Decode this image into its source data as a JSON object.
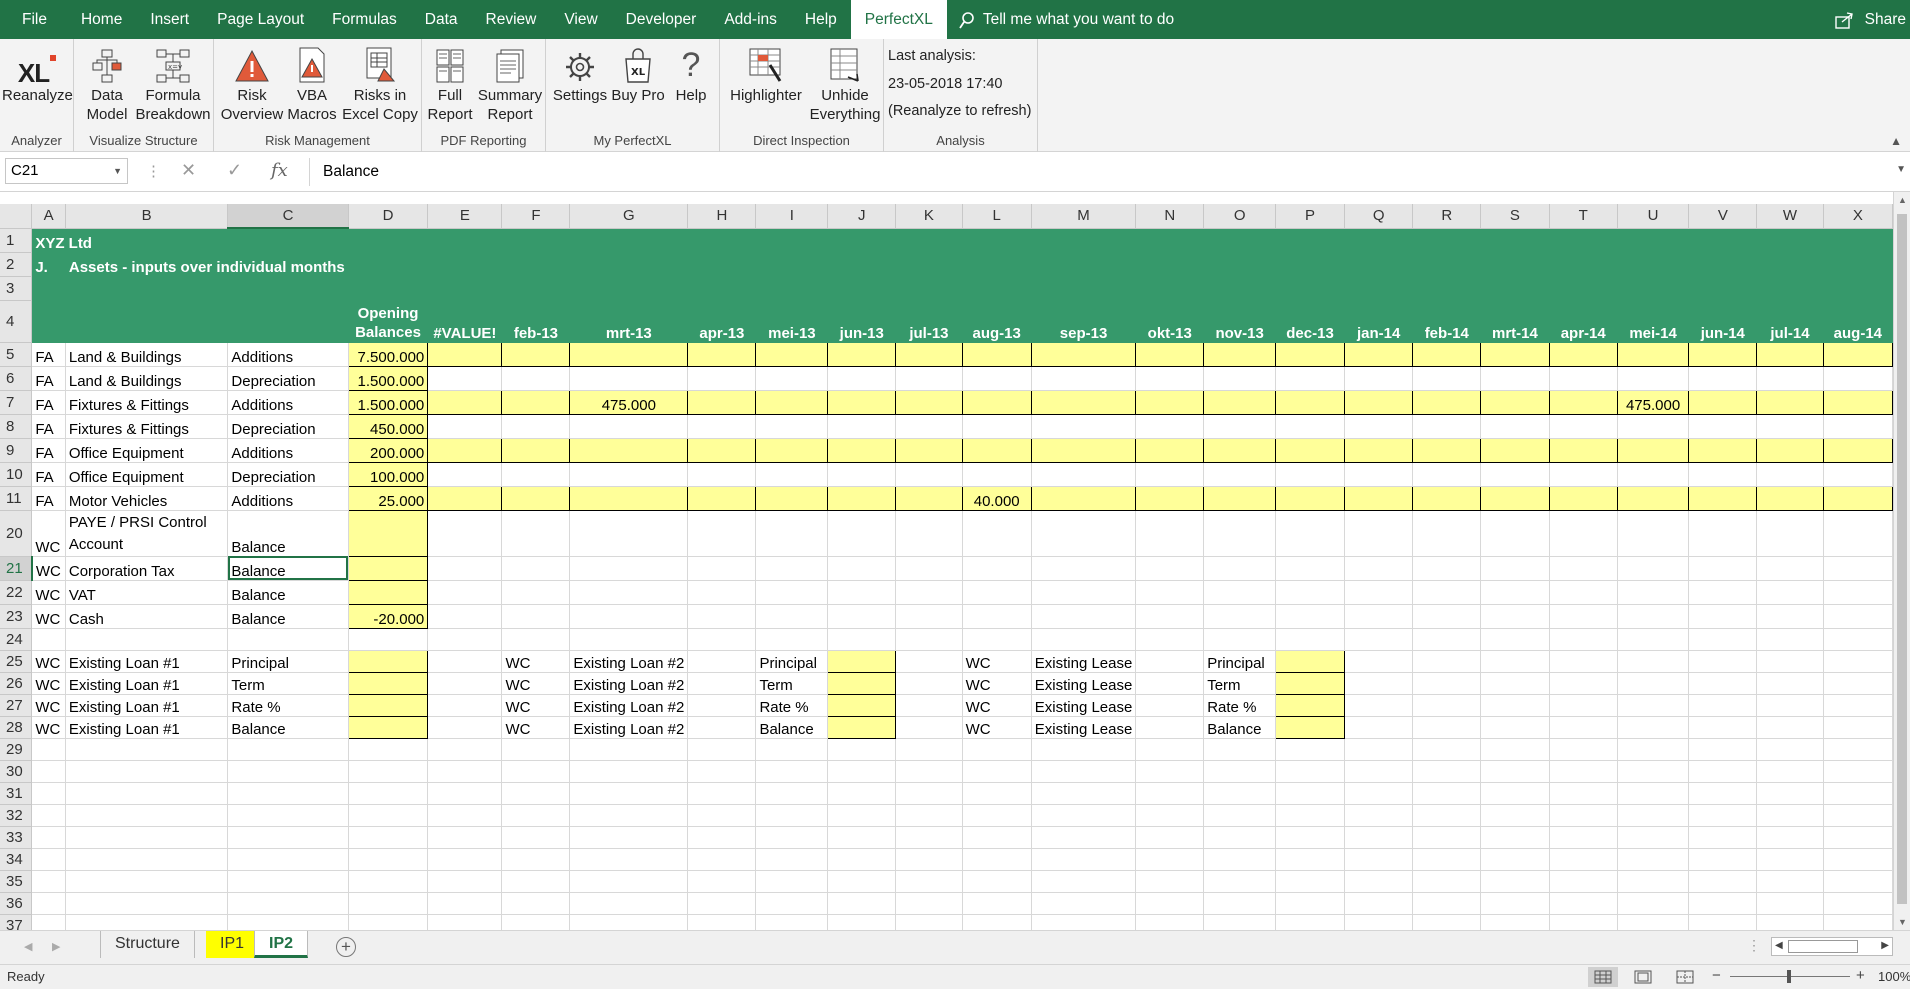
{
  "menu": {
    "tabs": [
      "File",
      "Home",
      "Insert",
      "Page Layout",
      "Formulas",
      "Data",
      "Review",
      "View",
      "Developer",
      "Add-ins",
      "Help",
      "PerfectXL"
    ],
    "tell_me": "Tell me what you want to do",
    "share": "Share"
  },
  "ribbon": {
    "groups": {
      "analyzer": "Analyzer",
      "visualize": "Visualize Structure",
      "risk": "Risk Management",
      "pdf": "PDF Reporting",
      "myperfectxl": "My PerfectXL",
      "inspection": "Direct Inspection",
      "analysis": "Analysis"
    },
    "buttons": {
      "reanalyze": "Reanalyze",
      "data_model": "Data\nModel",
      "formula_breakdown": "Formula\nBreakdown",
      "risk_overview": "Risk\nOverview",
      "vba_macros": "VBA\nMacros",
      "risks_excel_copy": "Risks in\nExcel Copy",
      "full_report": "Full\nReport",
      "summary_report": "Summary\nReport",
      "settings": "Settings",
      "buy_pro": "Buy Pro",
      "help": "Help",
      "highlighter": "Highlighter",
      "unhide": "Unhide\nEverything"
    },
    "logo_text": "XL",
    "last_analysis_label": "Last analysis:",
    "last_analysis_time": "23-05-2018 17:40",
    "refresh_hint": "(Reanalyze to refresh)"
  },
  "formula_bar": {
    "name_box": "C21",
    "formula": "Balance"
  },
  "columns": [
    "A",
    "B",
    "C",
    "D",
    "E",
    "F",
    "G",
    "H",
    "I",
    "J",
    "K",
    "L",
    "M",
    "N",
    "O",
    "P",
    "Q",
    "R",
    "S",
    "T",
    "U",
    "V",
    "W",
    "X"
  ],
  "sheet": {
    "title": "XYZ Ltd",
    "section_letter": "J.",
    "section_title": "Assets - inputs over individual months",
    "opening_1": "Opening",
    "opening_2": "Balances",
    "month_headers": [
      "#VALUE!",
      "feb-13",
      "mrt-13",
      "apr-13",
      "mei-13",
      "jun-13",
      "jul-13",
      "aug-13",
      "sep-13",
      "okt-13",
      "nov-13",
      "dec-13",
      "jan-14",
      "feb-14",
      "mrt-14",
      "apr-14",
      "mei-14",
      "jun-14",
      "jul-14",
      "aug-14"
    ],
    "asset_rows": [
      {
        "row": "5",
        "a": "FA",
        "b": "Land & Buildings",
        "c": "Additions",
        "d": "7.500.000",
        "months": {}
      },
      {
        "row": "6",
        "a": "FA",
        "b": "Land & Buildings",
        "c": "Depreciation",
        "d": "1.500.000",
        "months": {}
      },
      {
        "row": "7",
        "a": "FA",
        "b": "Fixtures & Fittings",
        "c": "Additions",
        "d": "1.500.000",
        "months": {
          "G": "475.000",
          "U": "475.000"
        }
      },
      {
        "row": "8",
        "a": "FA",
        "b": "Fixtures & Fittings",
        "c": "Depreciation",
        "d": "450.000",
        "months": {}
      },
      {
        "row": "9",
        "a": "FA",
        "b": "Office Equipment",
        "c": "Additions",
        "d": "200.000",
        "months": {}
      },
      {
        "row": "10",
        "a": "FA",
        "b": "Office Equipment",
        "c": "Depreciation",
        "d": "100.000",
        "months": {}
      },
      {
        "row": "11",
        "a": "FA",
        "b": "Motor Vehicles",
        "c": "Additions",
        "d": "25.000",
        "months": {
          "L": "40.000"
        }
      }
    ],
    "wc_rows": [
      {
        "row": "20",
        "a": "WC",
        "b1": "PAYE / PRSI Control",
        "b2": "Account",
        "c": "Balance",
        "d": ""
      },
      {
        "row": "21",
        "a": "WC",
        "b": "Corporation Tax",
        "c": "Balance",
        "d": ""
      },
      {
        "row": "22",
        "a": "WC",
        "b": "VAT",
        "c": "Balance",
        "d": ""
      },
      {
        "row": "23",
        "a": "WC",
        "b": "Cash",
        "c": "Balance",
        "d": "-20.000"
      }
    ],
    "loan_rows": [
      {
        "row": "25",
        "a": "WC",
        "loan1": "Existing Loan #1",
        "f1": "Principal",
        "loan2": "Existing Loan #2",
        "f2": "Principal",
        "lease": "Existing Lease",
        "f3": "Principal"
      },
      {
        "row": "26",
        "a": "WC",
        "loan1": "Existing Loan #1",
        "f1": "Term",
        "loan2": "Existing Loan #2",
        "f2": "Term",
        "lease": "Existing Lease",
        "f3": "Term"
      },
      {
        "row": "27",
        "a": "WC",
        "loan1": "Existing Loan #1",
        "f1": "Rate %",
        "loan2": "Existing Loan #2",
        "f2": "Rate %",
        "lease": "Existing Lease",
        "f3": "Rate %"
      },
      {
        "row": "28",
        "a": "WC",
        "loan1": "Existing Loan #1",
        "f1": "Balance",
        "loan2": "Existing Loan #2",
        "f2": "Balance",
        "lease": "Existing Lease",
        "f3": "Balance"
      }
    ],
    "empty_rows": [
      "29",
      "30",
      "31",
      "32",
      "33",
      "34",
      "35",
      "36",
      "37"
    ],
    "top_rows": [
      "1",
      "2",
      "3",
      "4",
      "24"
    ]
  },
  "sheet_tabs": [
    "Structure",
    "IP1",
    "IP2"
  ],
  "active_tab": "IP2",
  "status": {
    "ready": "Ready",
    "zoom": "100%"
  },
  "colors": {
    "excel_green": "#217346",
    "header_band": "#36996b",
    "input_yellow": "#ffff99"
  }
}
